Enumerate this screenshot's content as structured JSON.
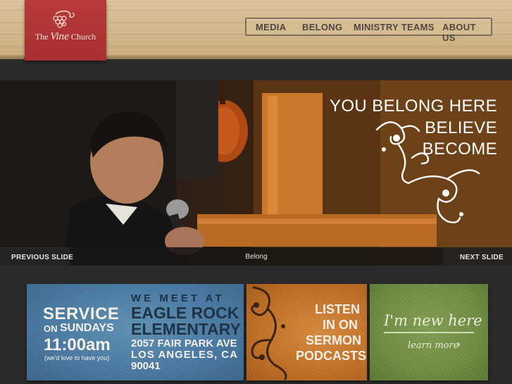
{
  "site": {
    "logo_name_prefix": "The",
    "logo_name_script": "Vine",
    "logo_name_suffix": "Church"
  },
  "nav": {
    "items": [
      "MEDIA",
      "BELONG",
      "MINISTRY TEAMS",
      "ABOUT US"
    ]
  },
  "hero": {
    "taglines": [
      "YOU BELONG HERE",
      "BELIEVE",
      "BECOME"
    ],
    "prev_label": "PREVIOUS SLIDE",
    "next_label": "NEXT SLIDE",
    "caption": "Belong"
  },
  "service": {
    "service": "SERVICE",
    "on": "ON",
    "sundays": "SUNDAYS",
    "time": "11:00am",
    "note": "(we'd love to have you)",
    "we_meet_at": "WE MEET AT",
    "venue_line1": "EAGLE ROCK",
    "venue_line2": "ELEMENTARY",
    "address_line1": "2057 FAIR PARK AVE",
    "address_line2": "LOS ANGELES, CA",
    "zip": "90041"
  },
  "podcast": {
    "lines": [
      "LISTEN",
      "IN ON",
      "SERMON",
      "PODCASTS"
    ]
  },
  "new_here": {
    "title": "I'm new here",
    "link": "learn more",
    "link_icon": "chevron-right-icon"
  },
  "colors": {
    "logo_red": "#a92f32",
    "service_blue": "#4878a0",
    "podcast_orange": "#bd6c22",
    "new_green": "#6b8a3f"
  }
}
